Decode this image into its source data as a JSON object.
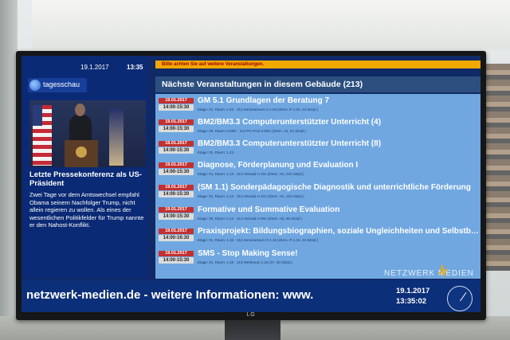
{
  "news": {
    "date": "19.1.2017",
    "time": "13:35",
    "source": "tagesschau",
    "headline": "Letzte Pressekonferenz als US-Präsident",
    "body": "Zwei Tage vor dem Amtswechsel empfahl Obama seinem Nachfolger Trump, nicht allein regieren zu wollen. Als eines der wesentlichen Politikfelder für Trump nannte er den Nahost-Konflikt."
  },
  "notice": "Bitte achten Sie auf weitere Veranstaltungen.",
  "events_header": "Nächste Veranstaltungen in diesem Gebäude (213)",
  "events": [
    {
      "date": "19.01.2017",
      "time": "14:00-15:30",
      "title": "GM 5.1 Grundlagen der Beratung 7",
      "detail": "Etage: 01, Raum: 1.63 · 213 Seminarraum S 1.63 (shem. R 1.63, 24 Sitzpl.)"
    },
    {
      "date": "19.01.2017",
      "time": "14:00-15:30",
      "title": "BM2/BM3.3 Computerunterstützter Unterricht (4)",
      "detail": "Etage: 00, Raum: 0.M01 · 213 PC-Pool 0.M01 (shem. 22, 24 Sitzpl.)"
    },
    {
      "date": "19.01.2017",
      "time": "14:00-15:30",
      "title": "BM2/BM3.3 Computerunterstützter Unterricht (8)",
      "detail": "Etage: 01, Raum: 1.23 ·"
    },
    {
      "date": "19.01.2017",
      "time": "14:00-15:30",
      "title": "Diagnose, Förderplanung und Evaluation I",
      "detail": "Etage: 01, Raum: 1.13 · 213 Hörsaal H 101 (shem. H1, 210 Sitzpl.)"
    },
    {
      "date": "19.01.2017",
      "time": "14:00-15:30",
      "title": "(SM 1.1) Sonderpädagogische Diagnostik und unterrichtliche Förderung",
      "detail": "Etage: 01, Raum: 1.13 · 213 Hörsaal H 101 (shem. H1, 210 Sitzpl.)"
    },
    {
      "date": "19.01.2017",
      "time": "14:00-15:30",
      "title": "Formative und Summative Evaluation",
      "detail": "Etage: 00, Raum: 0.14 · 213 Hörsaal H 062 (shem. H2, 90 Sitzpl.)"
    },
    {
      "date": "19.01.2017",
      "time": "14:00-16:30",
      "title": "Praxisprojekt: Bildungsbiographien, soziale Ungleichheiten und Selbstbilder",
      "detail": "Etage: 01, Raum: 1.16 · 213 Seminarraum S 1.16 (shem. R 1.16, 24 Sitzpl.)"
    },
    {
      "date": "19.01.2017",
      "time": "14:00-15:30",
      "title": "SMS - Stop Making Sense!",
      "detail": "Etage: 01, Raum: 1.18 · 213 Werkraum 1.18 (47, 30 Sitzpl.)"
    }
  ],
  "brand": "NETZWERK MEDIEN",
  "ticker": {
    "text": "netzwerk-medien.de - weitere Informationen: www.",
    "date": "19.1.2017",
    "time": "13:35:02"
  },
  "tv_brand": "LG"
}
